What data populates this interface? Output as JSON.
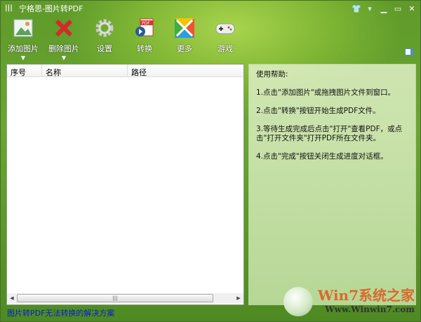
{
  "window": {
    "title": "宁格思-图片转PDF",
    "controls": [
      "skin-icon",
      "menu-icon",
      "minimize-icon",
      "maximize-icon",
      "close-icon"
    ]
  },
  "toolbar": [
    {
      "label": "添加图片",
      "icon": "add-image-icon",
      "dropdown": true
    },
    {
      "label": "删除图片",
      "icon": "delete-icon",
      "dropdown": true
    },
    {
      "label": "设置",
      "icon": "gear-icon",
      "dropdown": false
    },
    {
      "label": "转换",
      "icon": "pdf-convert-icon",
      "dropdown": false
    },
    {
      "label": "更多",
      "icon": "more-icon",
      "dropdown": false
    },
    {
      "label": "游戏",
      "icon": "gamepad-icon",
      "dropdown": false
    }
  ],
  "list": {
    "columns": [
      "序号",
      "名称",
      "路径"
    ],
    "rows": []
  },
  "help": {
    "title": "使用帮助:",
    "steps": [
      "1.点击\"添加图片\"或拖拽图片文件到窗口。",
      "2.点击\"转换\"按钮开始生成PDF文件。",
      "3.等待生成完成后点击\"打开\"查看PDF，或点击\"打开文件夹\"打开PDF所在文件夹。",
      "4.点击\"完成\"按钮关闭生成进度对话框。"
    ]
  },
  "footer": {
    "link": "图片转PDF无法转换的解决方案"
  },
  "watermark": {
    "brand": "Win7系统之家",
    "url": "Www.Winwin7.com"
  }
}
